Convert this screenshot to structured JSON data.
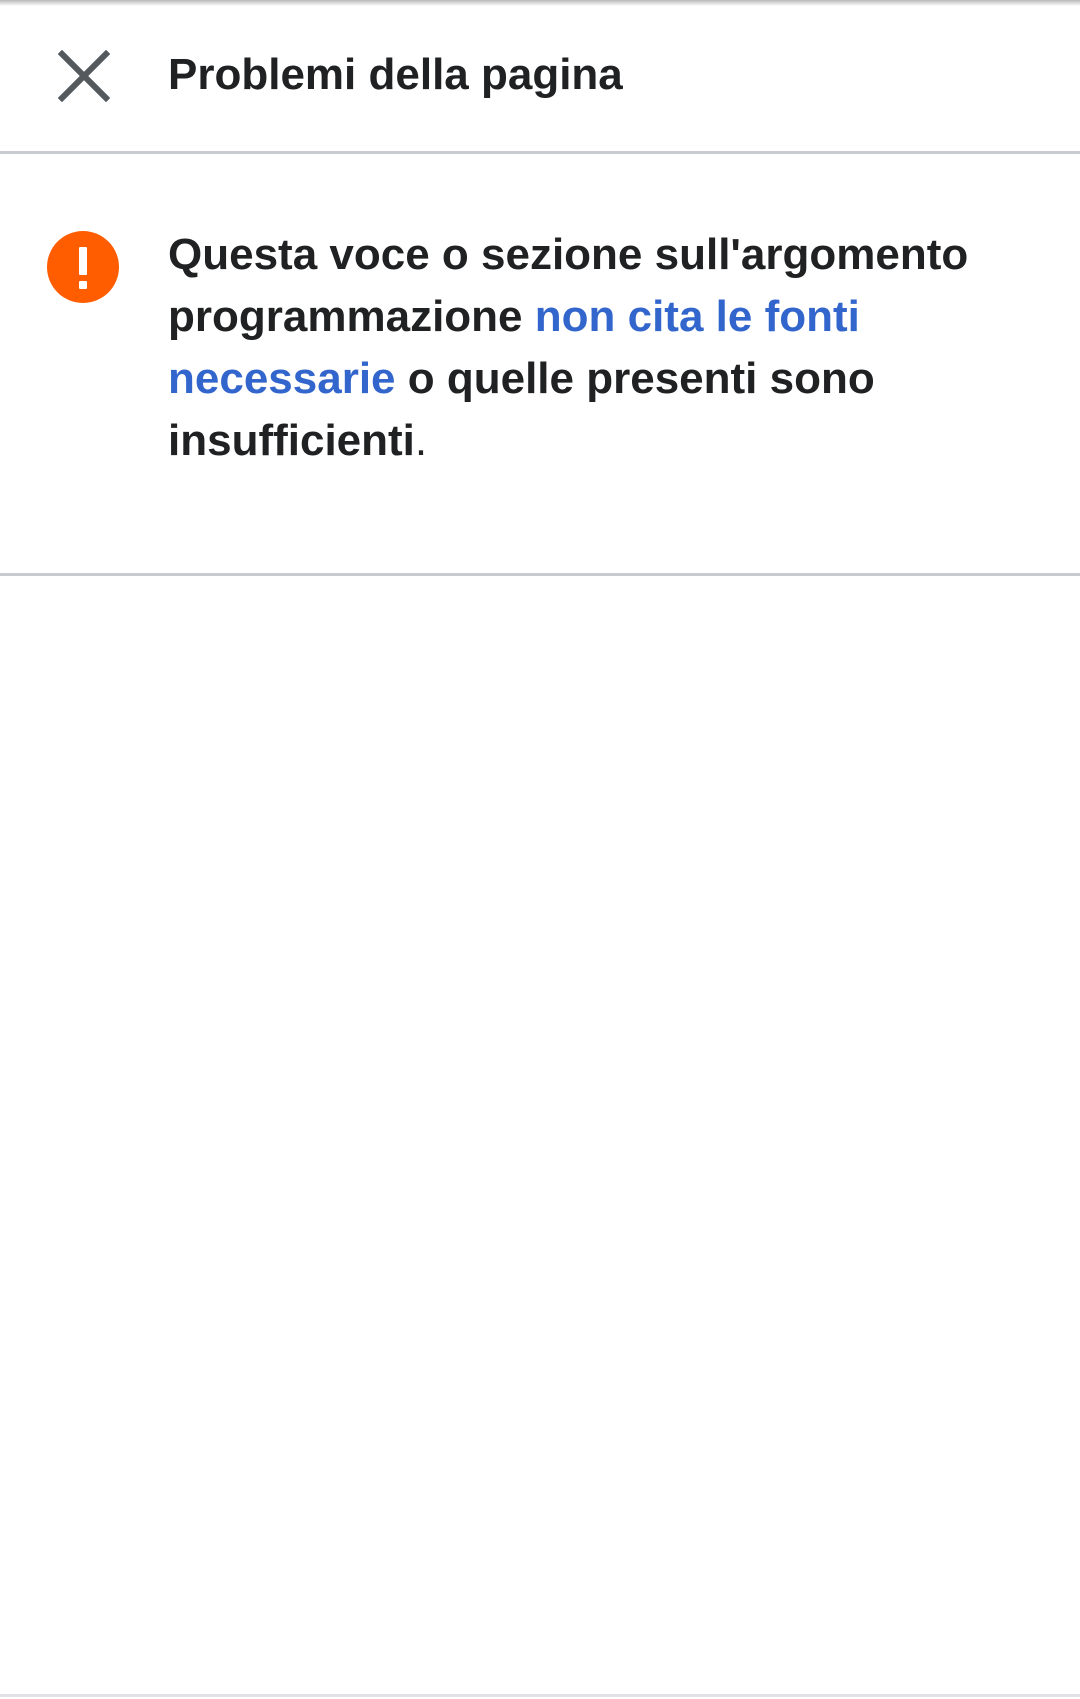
{
  "header": {
    "close_icon": "close-icon",
    "title": "Problemi della pagina"
  },
  "issue": {
    "icon": "alert-icon",
    "icon_color": "#ff5d00",
    "text_before": "Questa voce o sezione sull'argomento programmazione ",
    "link_text": "non cita le fonti necessarie",
    "text_after": " o quelle presenti sono insufficienti",
    "period": "."
  },
  "colors": {
    "text": "#202122",
    "link": "#3366cc",
    "divider": "#c8ccd1",
    "icon_gray": "#54595d"
  }
}
